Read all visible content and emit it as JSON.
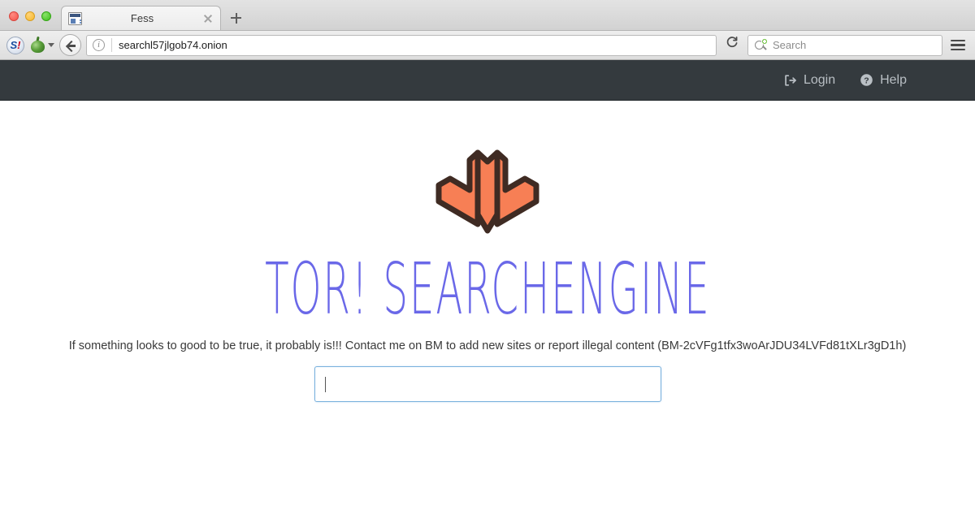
{
  "browser": {
    "window_controls": [
      "close",
      "minimize",
      "maximize"
    ],
    "tab": {
      "title": "Fess",
      "favicon": "document-favicon",
      "close_label": "×"
    },
    "new_tab_label": "+",
    "toolbar": {
      "extension_sbang": "S",
      "extension_sbang_bang": "!",
      "onion_button": "tor-onion-icon",
      "back_label": "Back",
      "info_label": "i",
      "url": "searchl57jlgob74.onion",
      "reload_label": "↻",
      "search_placeholder": "Search",
      "menu_label": "Menu"
    }
  },
  "topnav": {
    "background": "#343a3e",
    "links": [
      {
        "icon": "sign-in-icon",
        "label": "Login"
      },
      {
        "icon": "question-circle-icon",
        "label": "Help"
      }
    ]
  },
  "hero": {
    "logo": {
      "name": "tor-searchengine-logo",
      "fill": "#f77f55",
      "stroke": "#3f2b23"
    },
    "brand": {
      "part1": "TOR",
      "bang": "!",
      "part2": "SEARCHENGINE",
      "color": "#6a68e8"
    },
    "tagline": "If something looks to good to be true, it probably is!!! Contact me on BM to add new sites or report illegal content (BM-2cVFg1tfx3woArJDU34LVFd81tXLr3gD1h)",
    "search": {
      "value": "",
      "placeholder": "",
      "focused": true,
      "border_color": "#78b0dd"
    }
  }
}
